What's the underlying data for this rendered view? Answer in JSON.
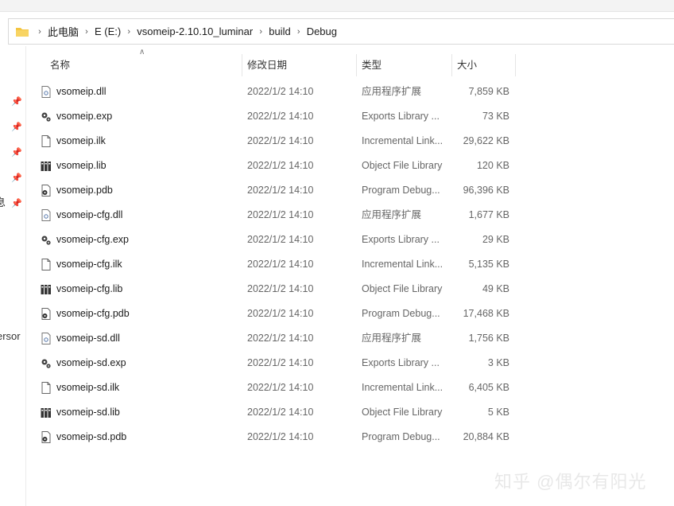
{
  "address_bar": {
    "crumbs": [
      "此电脑",
      "E (E:)",
      "vsomeip-2.10.10_luminar",
      "build",
      "Debug"
    ]
  },
  "nav_pane": {
    "cut_labels": [
      "息",
      "ersor"
    ]
  },
  "columns": {
    "name": "名称",
    "date": "修改日期",
    "type": "类型",
    "size": "大小"
  },
  "files": [
    {
      "name": "vsomeip.dll",
      "date": "2022/1/2 14:10",
      "type": "应用程序扩展",
      "size": "7,859 KB",
      "icon": "dll-file-icon"
    },
    {
      "name": "vsomeip.exp",
      "date": "2022/1/2 14:10",
      "type": "Exports Library ...",
      "size": "73 KB",
      "icon": "exp-file-icon"
    },
    {
      "name": "vsomeip.ilk",
      "date": "2022/1/2 14:10",
      "type": "Incremental Link...",
      "size": "29,622 KB",
      "icon": "ilk-file-icon"
    },
    {
      "name": "vsomeip.lib",
      "date": "2022/1/2 14:10",
      "type": "Object File Library",
      "size": "120 KB",
      "icon": "lib-file-icon"
    },
    {
      "name": "vsomeip.pdb",
      "date": "2022/1/2 14:10",
      "type": "Program Debug...",
      "size": "96,396 KB",
      "icon": "pdb-file-icon"
    },
    {
      "name": "vsomeip-cfg.dll",
      "date": "2022/1/2 14:10",
      "type": "应用程序扩展",
      "size": "1,677 KB",
      "icon": "dll-file-icon"
    },
    {
      "name": "vsomeip-cfg.exp",
      "date": "2022/1/2 14:10",
      "type": "Exports Library ...",
      "size": "29 KB",
      "icon": "exp-file-icon"
    },
    {
      "name": "vsomeip-cfg.ilk",
      "date": "2022/1/2 14:10",
      "type": "Incremental Link...",
      "size": "5,135 KB",
      "icon": "ilk-file-icon"
    },
    {
      "name": "vsomeip-cfg.lib",
      "date": "2022/1/2 14:10",
      "type": "Object File Library",
      "size": "49 KB",
      "icon": "lib-file-icon"
    },
    {
      "name": "vsomeip-cfg.pdb",
      "date": "2022/1/2 14:10",
      "type": "Program Debug...",
      "size": "17,468 KB",
      "icon": "pdb-file-icon"
    },
    {
      "name": "vsomeip-sd.dll",
      "date": "2022/1/2 14:10",
      "type": "应用程序扩展",
      "size": "1,756 KB",
      "icon": "dll-file-icon"
    },
    {
      "name": "vsomeip-sd.exp",
      "date": "2022/1/2 14:10",
      "type": "Exports Library ...",
      "size": "3 KB",
      "icon": "exp-file-icon"
    },
    {
      "name": "vsomeip-sd.ilk",
      "date": "2022/1/2 14:10",
      "type": "Incremental Link...",
      "size": "6,405 KB",
      "icon": "ilk-file-icon"
    },
    {
      "name": "vsomeip-sd.lib",
      "date": "2022/1/2 14:10",
      "type": "Object File Library",
      "size": "5 KB",
      "icon": "lib-file-icon"
    },
    {
      "name": "vsomeip-sd.pdb",
      "date": "2022/1/2 14:10",
      "type": "Program Debug...",
      "size": "20,884 KB",
      "icon": "pdb-file-icon"
    }
  ],
  "watermark": "知乎 @偶尔有阳光",
  "colors": {
    "folder": "#f4c541",
    "text": "#1b1b1b",
    "muted": "#666666"
  }
}
